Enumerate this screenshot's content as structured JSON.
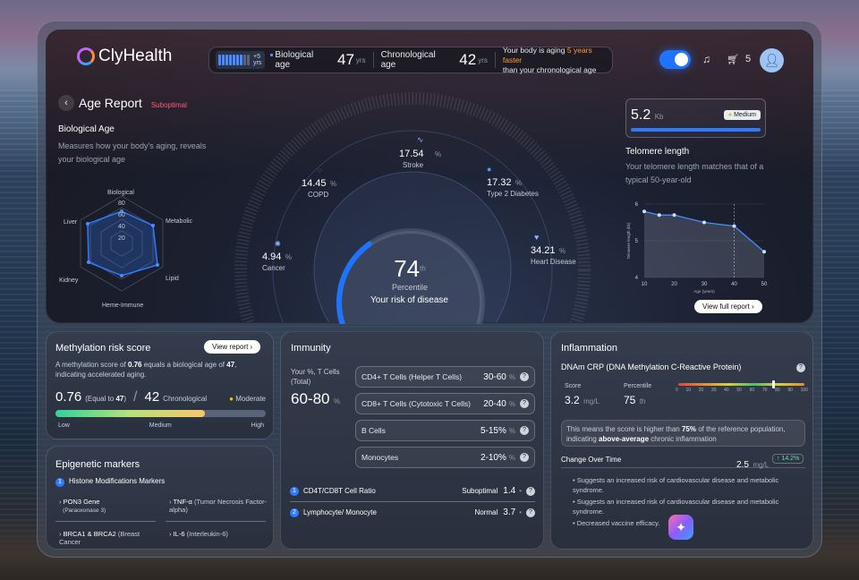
{
  "brand": "ClyHealth",
  "header": {
    "bars_label_top": "+5",
    "bars_label_bottom": "yrs",
    "bio_label": "Biological age",
    "bio_value": "47",
    "bio_unit": "yrs",
    "chrono_label": "Chronological age",
    "chrono_value": "42",
    "chrono_unit": "yrs",
    "aging_text_1": "Your body is aging ",
    "aging_highlight": "5 years faster",
    "aging_text_2": "than",
    "aging_text_3": " your chronological age",
    "cart_count": "5"
  },
  "report": {
    "title": "Age Report",
    "status": "Suboptimal"
  },
  "bio_age": {
    "heading": "Biological Age",
    "desc": "Measures how your body's aging, reveals your biological age",
    "radar_axes": [
      "Biological",
      "Metabolic",
      "Lipid",
      "Heme-Immune",
      "Kidney",
      "Liver"
    ],
    "radar_ticks": [
      "80",
      "60",
      "40",
      "20"
    ]
  },
  "risks": [
    {
      "value": "17.54",
      "unit": "%",
      "label": "Stroke",
      "icon": "pulse-icon"
    },
    {
      "value": "14.45",
      "unit": "%",
      "label": "COPD",
      "icon": "lungs-icon"
    },
    {
      "value": "17.32",
      "unit": "%",
      "label": "Type 2 Diabetes",
      "icon": "drop-icon"
    },
    {
      "value": "4.94",
      "unit": "%",
      "label": "Cancer",
      "icon": "cell-icon"
    },
    {
      "value": "34.21",
      "unit": "%",
      "label": "Heart Disease",
      "icon": "heart-icon"
    }
  ],
  "gauge": {
    "value": "74",
    "suffix": "th",
    "label": "Percentile",
    "caption": "Your risk of disease",
    "fraction": 0.74
  },
  "telomere": {
    "value": "5.2",
    "unit": "Kb",
    "badge": "Medium",
    "heading": "Telomere length",
    "desc": "Your telomere length matches that of a typical 50-year-old",
    "button": "View full report"
  },
  "chart_data": {
    "type": "line",
    "x": [
      10,
      15,
      20,
      30,
      40,
      50
    ],
    "y": [
      5.8,
      5.7,
      5.7,
      5.5,
      5.4,
      4.7
    ],
    "xlabel": "Age (years)",
    "ylabel": "Telomere length (kb)",
    "xlim": [
      10,
      50
    ],
    "ylim": [
      4,
      6
    ],
    "xticks": [
      "10",
      "20",
      "30",
      "40",
      "50"
    ],
    "yticks": [
      "6",
      "5",
      "4"
    ],
    "marker_x": 40
  },
  "methylation": {
    "heading": "Methylation risk score",
    "button": "View report",
    "desc_1": "A methylation score of ",
    "desc_score": "0.76",
    "desc_2": " equals a biological age of ",
    "desc_age": "47",
    "desc_3": ",",
    "desc_4": "indicating accelerated aging.",
    "score": "0.76",
    "equal_prefix": "(Equal to ",
    "equal_value": "47",
    "equal_suffix": ")",
    "chrono_value": "42",
    "chrono_label": "Chronological",
    "level": "Moderate",
    "scale": [
      "Low",
      "Medium",
      "High"
    ],
    "fraction": 0.71
  },
  "epigenetic": {
    "heading": "Epigenetic markers",
    "section_num": "1",
    "section": "Histone Modifications Markers",
    "items": [
      {
        "name": "PON3 Gene",
        "sub": "(Paraoxonase 3)"
      },
      {
        "name": "TNF-α",
        "sub": "(Tumor Necrosis Factor-alpha)"
      },
      {
        "name": "BRCA1 & BRCA2",
        "sub": "(Breast Cancer"
      },
      {
        "name": "IL-6",
        "sub": "(Interleukin-6)"
      }
    ]
  },
  "immunity": {
    "heading": "Immunity",
    "your_label": "Your %, T Cells (Total)",
    "total": "60-80",
    "total_unit": "%",
    "rows": [
      {
        "label": "CD4+ T Cells (Helper T Cells)",
        "value": "30-60",
        "unit": "%"
      },
      {
        "label": "CD8+ T Cells (Cytotoxic T Cells)",
        "value": "20-40",
        "unit": "%"
      },
      {
        "label": "B Cells",
        "value": "5-15%",
        "unit": "%"
      },
      {
        "label": "Monocytes",
        "value": "2-10%",
        "unit": "%"
      }
    ],
    "ratios": [
      {
        "num": "1",
        "label": "CD4T/CD8T Cell Ratio",
        "status": "Suboptimal",
        "value": "1.4"
      },
      {
        "num": "2",
        "label": "Lymphocyte/ Monocyte",
        "status": "Normal",
        "value": "3.7"
      }
    ]
  },
  "inflammation": {
    "heading": "Inflammation",
    "title": "DNAm CRP (DNA Methylation C-Reactive Protein)",
    "score_label": "Score",
    "score": "3.2",
    "score_unit": "mg/L",
    "pct_label": "Percentile",
    "pct": "75",
    "pct_unit": "th",
    "scale_ticks": [
      "0",
      "10",
      "20",
      "30",
      "40",
      "50",
      "60",
      "70",
      "80",
      "90",
      "100"
    ],
    "scale_fraction": 0.75,
    "note_1": "This means the score is higher than ",
    "note_pct": "75%",
    "note_2": " of the reference population,",
    "note_3": "indicating ",
    "note_bold": "above-average",
    "note_4": " chronic inflammation",
    "change_label": "Change Over Time",
    "change_value": "2.5",
    "change_unit": "mg/L",
    "change_badge": "↑ 14.2%",
    "bullets": [
      "Suggests an increased risk of cardiovascular disease and metabolic syndrome.",
      "Suggests an increased risk of cardiovascular disease and metabolic syndrome.",
      "Decreased vaccine efficacy."
    ]
  }
}
